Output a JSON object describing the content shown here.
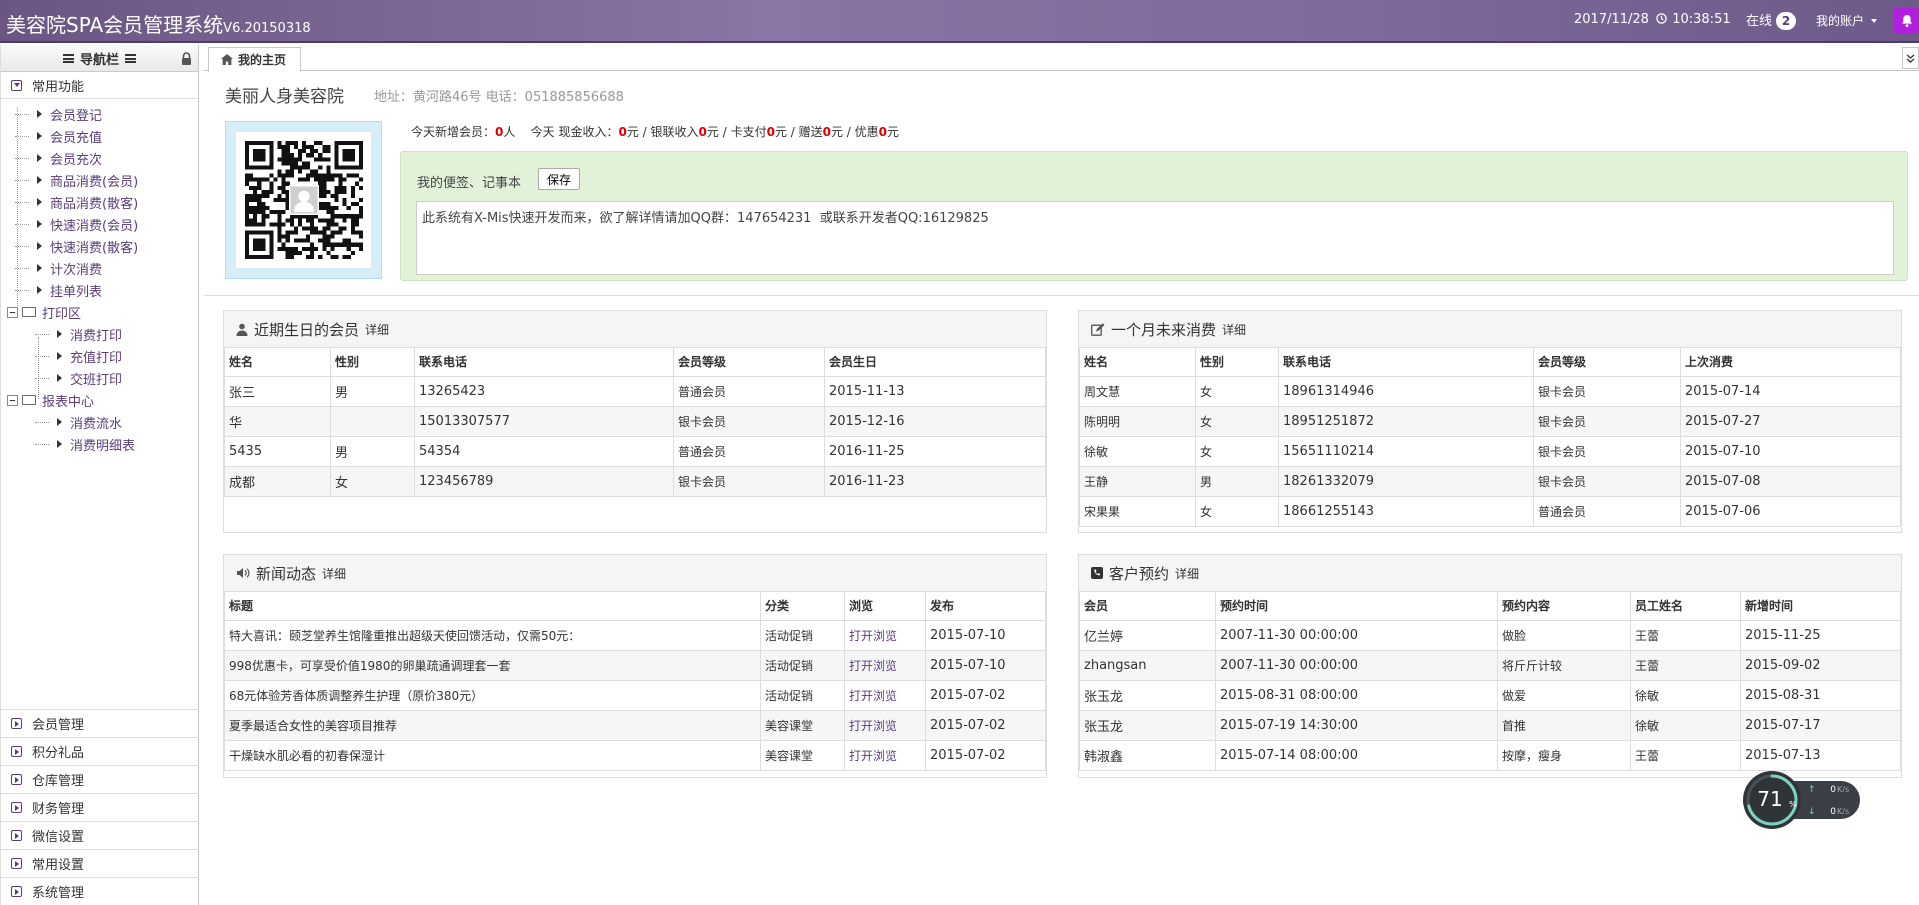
{
  "header": {
    "title": "美容院SPA会员管理系统",
    "version": "V6.20150318",
    "datetime": "2017/11/28",
    "time": "10:38:51",
    "online_label": "在线",
    "online_count": "2",
    "account_label": "我的账户"
  },
  "sidebar": {
    "nav_title": "导航栏",
    "common_title": "常用功能",
    "common_items": [
      {
        "label": "会员登记"
      },
      {
        "label": "会员充值"
      },
      {
        "label": "会员充次"
      },
      {
        "label": "商品消费(会员)"
      },
      {
        "label": "商品消费(散客)"
      },
      {
        "label": "快速消费(会员)"
      },
      {
        "label": "快速消费(散客)"
      },
      {
        "label": "计次消费"
      },
      {
        "label": "挂单列表"
      }
    ],
    "print_folder": "打印区",
    "print_items": [
      {
        "label": "消费打印"
      },
      {
        "label": "充值打印"
      },
      {
        "label": "交班打印"
      }
    ],
    "report_folder": "报表中心",
    "report_items": [
      {
        "label": "消费流水"
      },
      {
        "label": "消费明细表"
      }
    ],
    "bottom_sections": [
      {
        "label": "会员管理"
      },
      {
        "label": "积分礼品"
      },
      {
        "label": "仓库管理"
      },
      {
        "label": "财务管理"
      },
      {
        "label": "微信设置"
      },
      {
        "label": "常用设置"
      },
      {
        "label": "系统管理"
      }
    ]
  },
  "tabs": {
    "home": "我的主页"
  },
  "shop": {
    "name": "美丽人身美容院",
    "address": "地址：黄河路46号 电话：051885856688"
  },
  "today": {
    "new_members_label": "今天新增会员：",
    "new_members": "0",
    "unit_person": "人",
    "cash_label": "今天 现金收入：",
    "cash": "0",
    "unionpay_label": "元 / 银联收入",
    "unionpay": "0",
    "card_label": "元 / 卡支付",
    "card": "0",
    "gift_label": "元 / 赠送",
    "gift": "0",
    "discount_label": "元 / 优惠",
    "discount": "0",
    "unit_yuan": "元"
  },
  "memo": {
    "label": "我的便签、记事本",
    "save": "保存",
    "text": "此系统有X-Mis快速开发而来，欲了解详情请加QQ群：147654231  或联系开发者QQ:16129825"
  },
  "birthday_panel": {
    "title": "近期生日的会员",
    "more": "详细",
    "headers": [
      "姓名",
      "性别",
      "联系电话",
      "会员等级",
      "会员生日"
    ],
    "rows": [
      [
        "张三",
        "男",
        "13265423",
        "普通会员",
        "2015-11-13"
      ],
      [
        "华",
        "",
        "15013307577",
        "银卡会员",
        "2015-12-16"
      ],
      [
        "5435",
        "男",
        "54354",
        "普通会员",
        "2016-11-25"
      ],
      [
        "成都",
        "女",
        "123456789",
        "银卡会员",
        "2016-11-23"
      ]
    ]
  },
  "future_panel": {
    "title": "一个月未来消费",
    "more": "详细",
    "headers": [
      "姓名",
      "性别",
      "联系电话",
      "会员等级",
      "上次消费"
    ],
    "rows": [
      [
        "周文慧",
        "女",
        "18961314946",
        "银卡会员",
        "2015-07-14"
      ],
      [
        "陈明明",
        "女",
        "18951251872",
        "银卡会员",
        "2015-07-27"
      ],
      [
        "徐敏",
        "女",
        "15651110214",
        "银卡会员",
        "2015-07-10"
      ],
      [
        "王静",
        "男",
        "18261332079",
        "银卡会员",
        "2015-07-08"
      ],
      [
        "宋果果",
        "女",
        "18661255143",
        "普通会员",
        "2015-07-06"
      ]
    ]
  },
  "news_panel": {
    "title": "新闻动态",
    "more": "详细",
    "headers": [
      "标题",
      "分类",
      "浏览",
      "发布"
    ],
    "rows": [
      [
        "特大喜讯：颐芝堂养生馆隆重推出超级天使回馈活动，仅需50元：",
        "活动促销",
        "打开浏览",
        "2015-07-10"
      ],
      [
        "998优惠卡，可享受价值1980的卵巢疏通调理套一套",
        "活动促销",
        "打开浏览",
        "2015-07-10"
      ],
      [
        "68元体验芳香体质调整养生护理（原价380元）",
        "活动促销",
        "打开浏览",
        "2015-07-02"
      ],
      [
        "夏季最适合女性的美容项目推荐",
        "美容课堂",
        "打开浏览",
        "2015-07-02"
      ],
      [
        "干燥缺水肌必看的初春保湿计",
        "美容课堂",
        "打开浏览",
        "2015-07-02"
      ]
    ]
  },
  "booking_panel": {
    "title": "客户预约",
    "more": "详细",
    "headers": [
      "会员",
      "预约时间",
      "预约内容",
      "员工姓名",
      "新增时间"
    ],
    "rows": [
      [
        "亿兰婷",
        "2007-11-30 00:00:00",
        "做脸",
        "王蕾",
        "2015-11-25"
      ],
      [
        "zhangsan",
        "2007-11-30 00:00:00",
        "将斤斤计较",
        "王蕾",
        "2015-09-02"
      ],
      [
        "张玉龙",
        "2015-08-31 08:00:00",
        "做爱",
        "徐敏",
        "2015-08-31"
      ],
      [
        "张玉龙",
        "2015-07-19 14:30:00",
        "首推",
        "徐敏",
        "2015-07-17"
      ],
      [
        "韩淑鑫",
        "2015-07-14 08:00:00",
        "按摩，瘦身",
        "王蕾",
        "2015-07-13"
      ]
    ]
  },
  "net_widget": {
    "percent": "71",
    "percent_unit": "%",
    "up": "0",
    "down": "0",
    "rate_unit": "K/s"
  },
  "colors": {
    "header_purple": "#7a6797",
    "accent_red": "#e10000",
    "memo_green": "#e1f2d9",
    "qr_blue": "#d6eef8"
  }
}
